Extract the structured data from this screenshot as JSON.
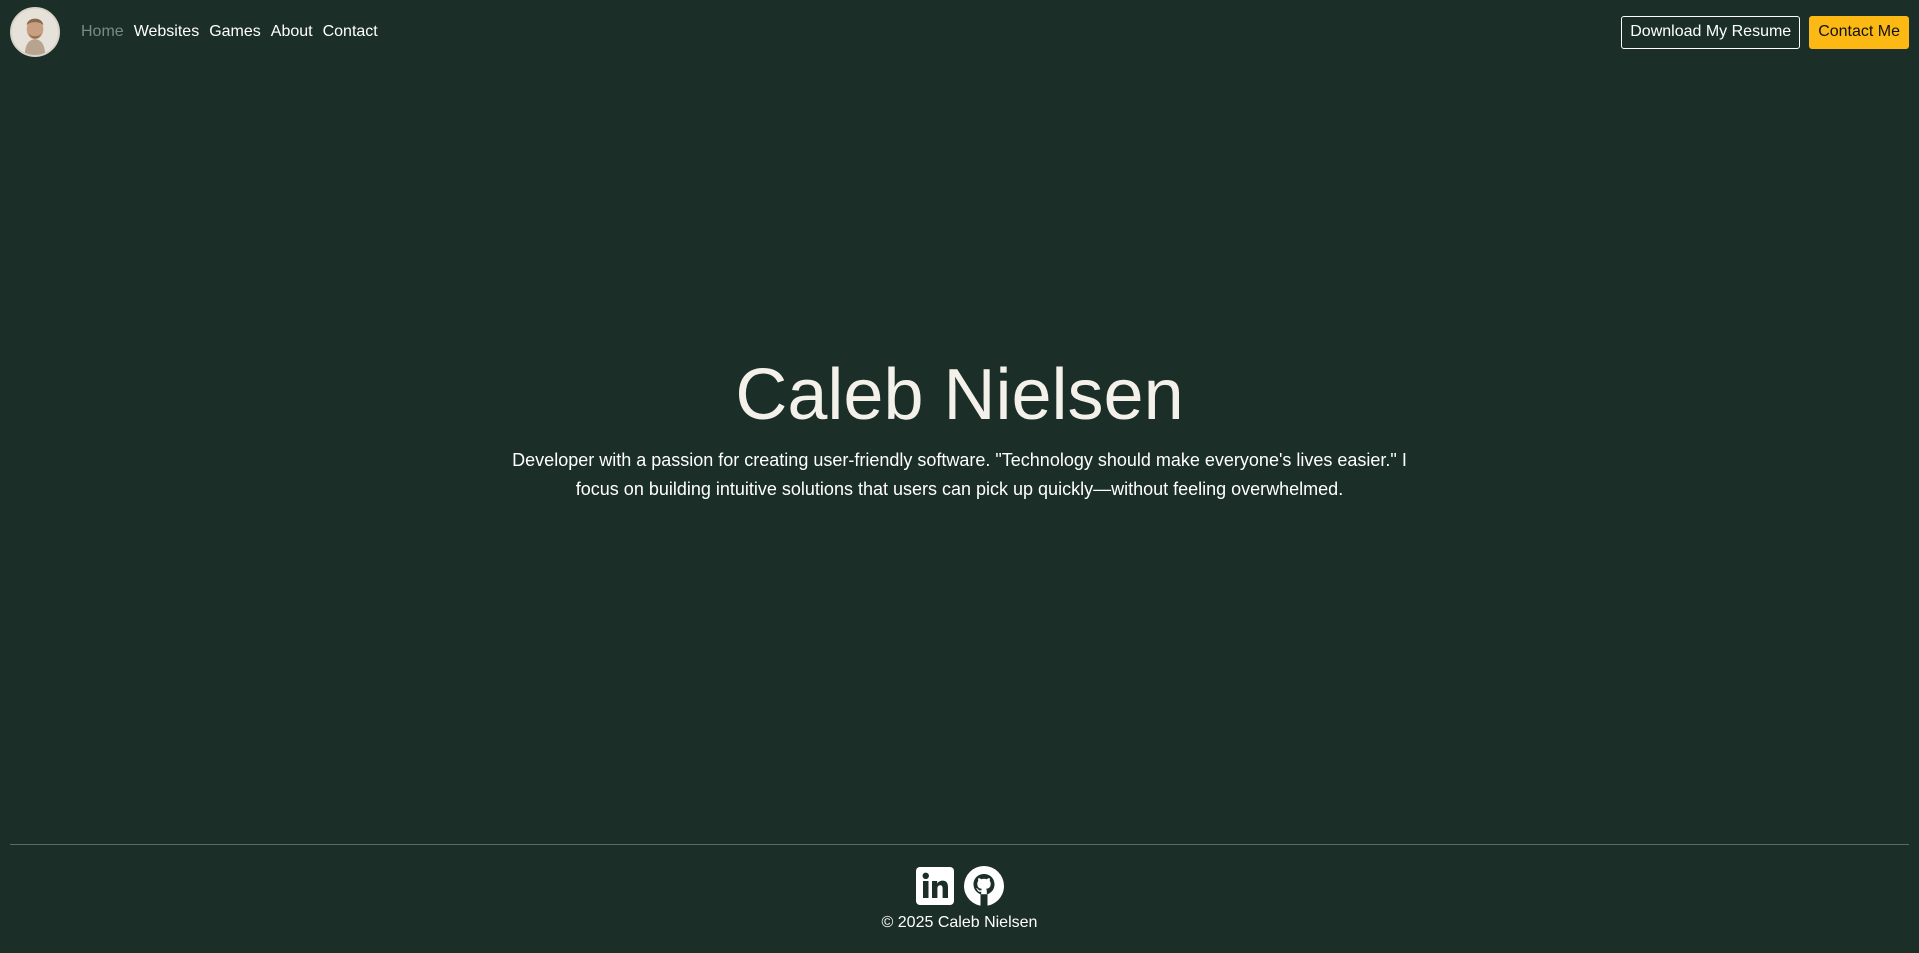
{
  "nav": {
    "avatar_alt": "avatar",
    "links": [
      {
        "label": "Home",
        "active": true
      },
      {
        "label": "Websites",
        "active": false
      },
      {
        "label": "Games",
        "active": false
      },
      {
        "label": "About",
        "active": false
      },
      {
        "label": "Contact",
        "active": false
      }
    ],
    "resume_button": "Download My Resume",
    "contact_button": "Contact Me"
  },
  "hero": {
    "title": "Caleb Nielsen",
    "description": "Developer with a passion for creating user-friendly software. \"Technology should make everyone's lives easier.\" I focus on building intuitive solutions that users can pick up quickly—without feeling overwhelmed."
  },
  "footer": {
    "social": [
      {
        "name": "linkedin-icon"
      },
      {
        "name": "github-icon"
      }
    ],
    "copyright": "© 2025 Caleb Nielsen"
  },
  "colors": {
    "background": "#1b2e28",
    "accent": "#fcb813",
    "active_link": "#7c8a85",
    "title_text": "#f4f1ea"
  }
}
